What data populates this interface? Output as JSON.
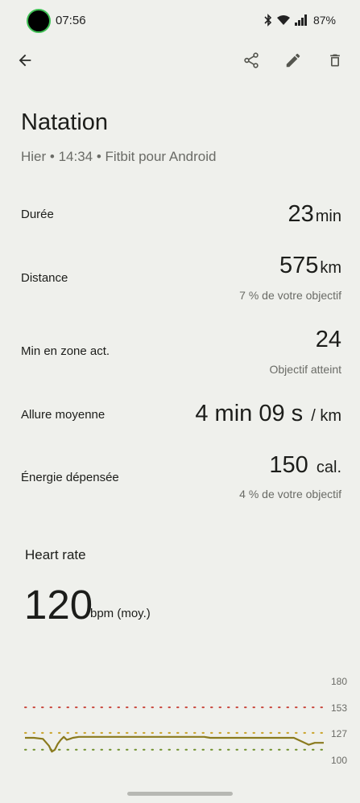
{
  "status_bar": {
    "time": "07:56",
    "battery": "87%"
  },
  "toolbar": {
    "back_icon": "arrow-back-icon",
    "share_icon": "share-icon",
    "edit_icon": "edit-pencil-icon",
    "delete_icon": "trash-icon"
  },
  "header": {
    "title": "Natation",
    "subtitle": "Hier • 14:34 • Fitbit pour Android"
  },
  "stats": [
    {
      "label": "Durée",
      "value": "23",
      "unit": "min",
      "sub": ""
    },
    {
      "label": "Distance",
      "value": "575",
      "unit": "km",
      "sub": "7 % de votre objectif"
    },
    {
      "label": "Min en zone act.",
      "value": "24",
      "unit": "",
      "sub": "Objectif atteint"
    },
    {
      "label": "Allure moyenne",
      "value": "4 min 09 s",
      "unit": "/ km",
      "sub": ""
    },
    {
      "label": "Énergie dépensée",
      "value": "150",
      "unit": "cal.",
      "sub": "4 % de votre objectif"
    }
  ],
  "heart_rate": {
    "title": "Heart rate",
    "value": "120",
    "unit": "bpm (moy.)"
  },
  "colors": {
    "background": "#eff0ec",
    "hr_line": "#8a7a1e",
    "zone_high": "#c9463c",
    "zone_mid": "#c9a227",
    "zone_low": "#6f8f2a"
  },
  "chart_data": {
    "type": "line",
    "ylim": [
      100,
      180
    ],
    "y_ticks": [
      180,
      153,
      127,
      100
    ],
    "reference_lines": [
      153,
      127,
      110
    ],
    "x": [
      0,
      3,
      6,
      8,
      9,
      10,
      11,
      12,
      13,
      14,
      15,
      16,
      18,
      20,
      24,
      28,
      35,
      45,
      55,
      60,
      62,
      65,
      70,
      75,
      85,
      90,
      95,
      97,
      100
    ],
    "y": [
      122,
      122,
      121,
      114,
      108,
      110,
      116,
      120,
      123,
      120,
      121,
      122,
      123,
      123,
      123,
      123,
      123,
      123,
      123,
      123,
      122,
      122,
      122,
      122,
      122,
      122,
      115,
      117,
      117
    ]
  }
}
